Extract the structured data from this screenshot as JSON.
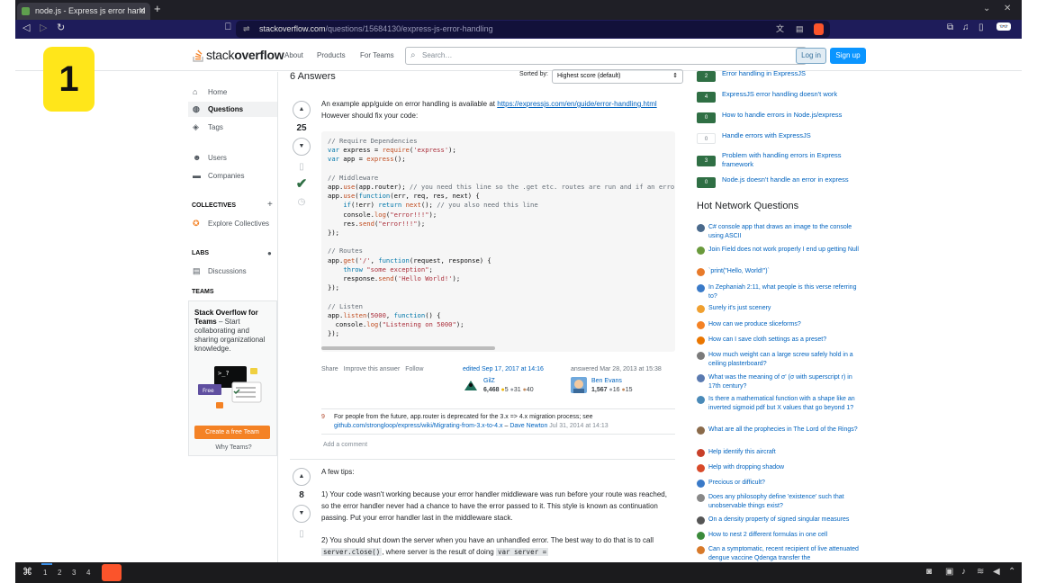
{
  "browser": {
    "tab_title": "node.js - Express js error hand",
    "url_domain": "stackoverflow.com",
    "url_path": "/questions/15684130/express-js-error-handling"
  },
  "overlay_badge": "1",
  "topbar": {
    "logo_prefix": "stack",
    "logo_suffix": "overflow",
    "nav": [
      "About",
      "Products",
      "For Teams"
    ],
    "search_placeholder": "Search…",
    "login": "Log in",
    "signup": "Sign up"
  },
  "leftnav": {
    "home": "Home",
    "questions": "Questions",
    "tags": "Tags",
    "users": "Users",
    "companies": "Companies",
    "collectives_head": "COLLECTIVES",
    "explore_collectives": "Explore Collectives",
    "labs_head": "LABS",
    "discussions": "Discussions",
    "teams_head": "TEAMS",
    "teams_title": "Stack Overflow for Teams",
    "teams_text": " – Start collaborating and sharing organizational knowledge.",
    "create_team": "Create a free Team",
    "why_teams": "Why Teams?"
  },
  "answers": {
    "heading": "6 Answers",
    "sorted_by": "Sorted by:",
    "sort_value": "Highest score (default)"
  },
  "answer1": {
    "score": "25",
    "intro_text": "An example app/guide on error handling is available at ",
    "link": "https://expressjs.com/en/guide/error-handling.html",
    "intro_tail": " However should fix your code:",
    "menu": [
      "Share",
      "Improve this answer",
      "Follow"
    ],
    "edited": "edited Sep 17, 2017 at 14:16",
    "editor_name": "GilZ",
    "editor_rep": "6,468",
    "editor_gold": "5",
    "editor_silver": "31",
    "editor_bronze": "40",
    "answered": "answered Mar 28, 2013 at 15:38",
    "author_name": "Ben Evans",
    "author_rep": "1,567",
    "author_silver": "16",
    "author_bronze": "15",
    "comment_score": "9",
    "comment_text": "For people from the future, app.router is deprecated for the 3.x => 4.x migration process; see",
    "comment_link": "github.com/strongloop/express/wiki/Migrating-from-3.x-to-4.x",
    "comment_author": "Dave Newton",
    "comment_date": "Jul 31, 2014 at 14:13",
    "add_comment": "Add a comment"
  },
  "answer2": {
    "score": "8",
    "p1": "A few tips:",
    "p2": "1) Your code wasn't working because your error handler middleware was run before your route was reached, so the error handler never had a chance to have the error passed to it. This style is known as continuation passing. Put your error handler last in the middleware stack.",
    "p3a": "2) You should shut down the server when you have an unhandled error. The best way to do that is to call ",
    "p3code1": "server.close()",
    "p3b": ", where server is the result of doing ",
    "p3code2": "var server ="
  },
  "related": [
    {
      "score": "2",
      "answered": true,
      "title": "Error handling in ExpressJS"
    },
    {
      "score": "4",
      "answered": true,
      "title": "ExpressJS error handling doesn't work"
    },
    {
      "score": "0",
      "answered": true,
      "title": "How to handle errors in Node.js/express"
    },
    {
      "score": "0",
      "answered": false,
      "title": "Handle errors with ExpressJS"
    },
    {
      "score": "3",
      "answered": true,
      "title": "Problem with handling errors in Express framework"
    },
    {
      "score": "0",
      "answered": true,
      "title": "Node.js doesn't handle an error in express"
    }
  ],
  "hnq_title": "Hot Network Questions",
  "hnq": [
    {
      "title": "C# console app that draws an image to the console using ASCII",
      "color": "#4a6a8c"
    },
    {
      "title": "Join Field does not work properly I end up getting Null",
      "color": "#6a9a3c"
    },
    {
      "title": "`print(\"Hello, World!\")`",
      "color": "#e87a2a"
    },
    {
      "title": "In Zephaniah 2:11, what people is this verse referring to?",
      "color": "#3a7ac8"
    },
    {
      "title": "Surely it's just scenery",
      "color": "#f0a030"
    },
    {
      "title": "How can we produce sliceforms?",
      "color": "#f48225"
    },
    {
      "title": "How can I save cloth settings as a preset?",
      "color": "#ea7600"
    },
    {
      "title": "How much weight can a large screw safely hold in a ceiling plasterboard?",
      "color": "#7a7a7a"
    },
    {
      "title": "What was the meaning of σ' (σ with superscript r) in 17th century?",
      "color": "#5a7ab0"
    },
    {
      "title": "Is there a mathematical function with a shape like an inverted sigmoid pdf but X values that go beyond 1?",
      "color": "#4a8ab8"
    },
    {
      "title": "What are all the prophecies in The Lord of the Rings?",
      "color": "#8a6a4a"
    },
    {
      "title": "Help identify this aircraft",
      "color": "#c8402a"
    },
    {
      "title": "Help with dropping shadow",
      "color": "#d84a2a"
    },
    {
      "title": "Precious or difficult?",
      "color": "#3a7ac8"
    },
    {
      "title": "Does any philosophy define 'existence' such that unobservable things exist?",
      "color": "#888888"
    },
    {
      "title": "On a density property of signed singular measures",
      "color": "#555555"
    },
    {
      "title": "How to nest 2 different formulas in one cell",
      "color": "#3a8a3a"
    },
    {
      "title": "Can a symptomatic, recent recipient of live attenuated dengue vaccine Qdenga transfer the",
      "color": "#d87a2a"
    }
  ],
  "taskbar": {
    "workspaces": [
      "1",
      "2",
      "3",
      "4"
    ]
  }
}
